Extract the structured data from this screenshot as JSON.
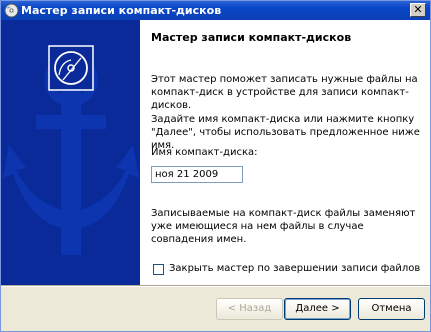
{
  "window": {
    "title": "Мастер записи компакт-дисков",
    "close_label": "✕"
  },
  "main": {
    "heading": "Мастер записи компакт-дисков",
    "intro": "Этот мастер поможет записать нужные файлы на компакт-диск в устройстве для записи компакт-дисков.",
    "instruction": "Задайте имя компакт-диска или нажмите кнопку \"Далее\", чтобы использовать предложенное ниже имя.",
    "name_label": "Имя компакт-диска:",
    "name_value": "ноя 21 2009",
    "overwrite_note": "Записываемые на компакт-диск файлы заменяют уже имеющиеся на нем файлы в случае совпадения имен.",
    "close_checkbox_label": "Закрыть мастер по завершении записи файлов",
    "close_checkbox_checked": false
  },
  "buttons": {
    "back": "< Назад",
    "next": "Далее >",
    "cancel": "Отмена"
  },
  "colors": {
    "sidebar": "#0a2a9a",
    "titlebar": "#0a46c9"
  },
  "icons": {
    "sidebar": "cd-disc-anchor-graphic",
    "title": "cd-writer-icon"
  }
}
